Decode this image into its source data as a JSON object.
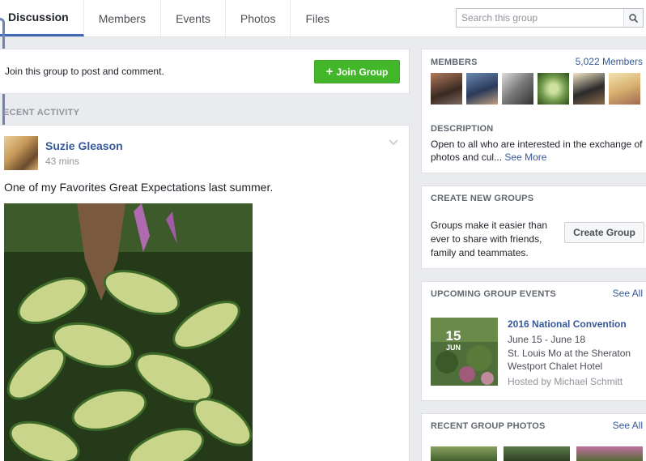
{
  "tabs": [
    "Discussion",
    "Members",
    "Events",
    "Photos",
    "Files"
  ],
  "search": {
    "placeholder": "Search this group",
    "icon": "search-icon"
  },
  "join": {
    "prompt": "Join this group to post and comment.",
    "button_label": "Join Group",
    "button_color": "#42b72a"
  },
  "recent_activity": {
    "heading": "RECENT ACTIVITY",
    "heading_visible": "ECENT ACTIVITY"
  },
  "post": {
    "author": "Suzie Gleason",
    "time": "43 mins",
    "text": "One of my Favorites Great Expectations last summer."
  },
  "members": {
    "heading": "MEMBERS",
    "count_link": "5,022 Members"
  },
  "description": {
    "heading": "DESCRIPTION",
    "text": "Open to all who are interested in the exchange of photos and cul...",
    "more": "See More"
  },
  "create_groups": {
    "heading": "CREATE NEW GROUPS",
    "body": "Groups make it easier than ever to share with friends, family and teammates.",
    "button_label": "Create Group"
  },
  "events": {
    "heading": "UPCOMING GROUP EVENTS",
    "see_all": "See All",
    "day": "15",
    "month": "JUN",
    "title": "2016 National Convention",
    "dates": "June 15 - June 18",
    "location_line1": "St. Louis Mo at the Sheraton",
    "location_line2": "Westport Chalet Hotel",
    "host": "Hosted by Michael Schmitt"
  },
  "photos": {
    "heading": "RECENT GROUP PHOTOS",
    "see_all": "See All"
  },
  "colors": {
    "link": "#365899",
    "accent": "#4267b2",
    "background": "#e9ebee"
  }
}
